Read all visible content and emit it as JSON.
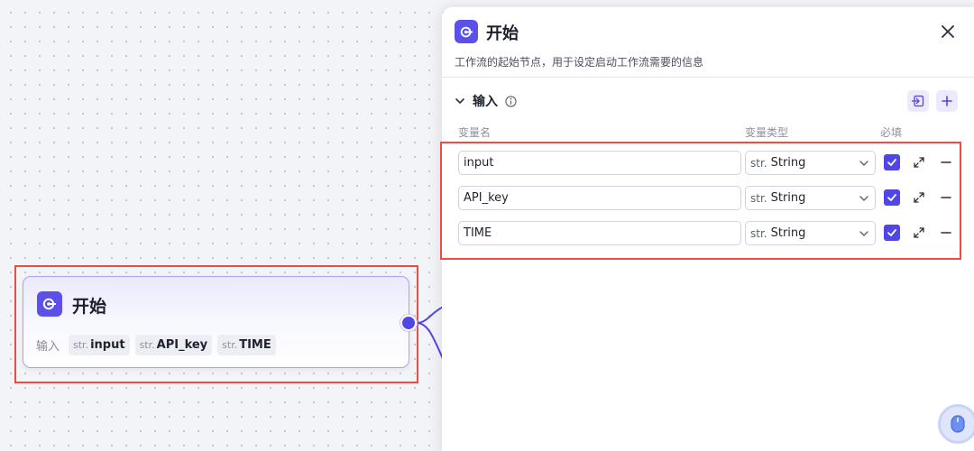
{
  "node": {
    "title": "开始",
    "input_label": "输入",
    "tags": [
      {
        "type": "str.",
        "name": "input"
      },
      {
        "type": "str.",
        "name": "API_key"
      },
      {
        "type": "str.",
        "name": "TIME"
      }
    ]
  },
  "panel": {
    "title": "开始",
    "description": "工作流的起始节点，用于设定启动工作流需要的信息",
    "section": {
      "title": "输入",
      "info_glyph": "ⓘ",
      "collapse_glyph": "⌄"
    },
    "columns": {
      "name": "变量名",
      "type": "变量类型",
      "required": "必填"
    },
    "rows": [
      {
        "name": "input",
        "type_prefix": "str.",
        "type": "String",
        "required": true
      },
      {
        "name": "API_key",
        "type_prefix": "str.",
        "type": "String",
        "required": true
      },
      {
        "name": "TIME",
        "type_prefix": "str.",
        "type": "String",
        "required": true
      }
    ]
  },
  "colors": {
    "accent": "#4f46e5",
    "highlight": "#ee4b45"
  }
}
